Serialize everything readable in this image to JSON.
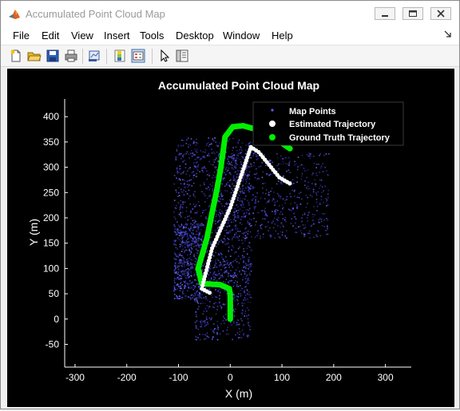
{
  "window": {
    "title": "Accumulated Point Cloud Map",
    "icon": "matlab-icon",
    "controls": [
      "minimize-icon",
      "maximize-icon",
      "close-icon"
    ]
  },
  "menubar": {
    "items": [
      "File",
      "Edit",
      "View",
      "Insert",
      "Tools",
      "Desktop",
      "Window",
      "Help"
    ],
    "dock_icon": "dock-arrow-icon"
  },
  "toolbar": {
    "buttons": [
      "new-figure-icon",
      "open-file-icon",
      "save-icon",
      "print-icon",
      "link-plot-icon",
      "colorbar-icon",
      "legend-icon",
      "pointer-icon",
      "property-inspector-icon"
    ]
  },
  "colors": {
    "background": "#000000",
    "map_points": "#4a4ae0",
    "estimated": "#ffffff",
    "ground_truth": "#00ee00"
  },
  "chart_data": {
    "type": "scatter",
    "title": "Accumulated Point Cloud Map",
    "xlabel": "X (m)",
    "ylabel": "Y (m)",
    "xlim": [
      -320,
      350
    ],
    "ylim": [
      -95,
      435
    ],
    "xticks": [
      -300,
      -200,
      -100,
      0,
      100,
      200,
      300
    ],
    "yticks": [
      -50,
      0,
      50,
      100,
      150,
      200,
      250,
      300,
      350,
      400
    ],
    "xticklabels": [
      "-300",
      "-200",
      "-100",
      "0",
      "100",
      "200",
      "300"
    ],
    "yticklabels": [
      "-50",
      "0",
      "50",
      "100",
      "150",
      "200",
      "250",
      "300",
      "350",
      "400"
    ],
    "grid": false,
    "legend_position": "top-right",
    "series": [
      {
        "name": "Map Points",
        "type": "scatter",
        "color": "#4a4ae0",
        "regions": [
          {
            "xmin": -110,
            "xmax": 40,
            "ymin": 80,
            "ymax": 360
          },
          {
            "xmin": -70,
            "xmax": 40,
            "ymin": -40,
            "ymax": 120
          },
          {
            "xmin": -30,
            "xmax": 190,
            "ymin": 160,
            "ymax": 330
          },
          {
            "xmin": -110,
            "xmax": -55,
            "ymin": 40,
            "ymax": 190
          }
        ]
      },
      {
        "name": "Estimated Trajectory",
        "type": "line",
        "color": "#ffffff",
        "x": [
          -40,
          -55,
          -35,
          0,
          20,
          35,
          40,
          55,
          75,
          95,
          120
        ],
        "y": [
          52,
          60,
          140,
          220,
          280,
          325,
          340,
          330,
          305,
          280,
          265
        ]
      },
      {
        "name": "Ground Truth Trajectory",
        "type": "line",
        "color": "#00ee00",
        "x": [
          0,
          0,
          -2,
          -20,
          -55,
          -62,
          -45,
          -25,
          -18,
          -10,
          5,
          25,
          50,
          80,
          118
        ],
        "y": [
          0,
          50,
          60,
          68,
          70,
          100,
          160,
          260,
          300,
          360,
          380,
          382,
          375,
          362,
          335
        ]
      }
    ]
  }
}
